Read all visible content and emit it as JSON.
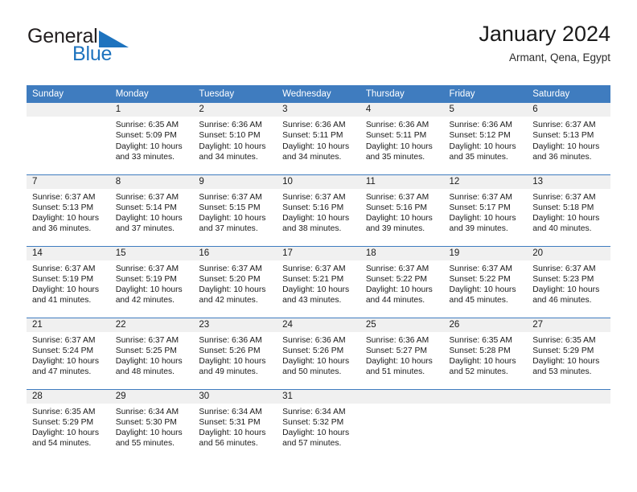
{
  "brand": {
    "name_part1": "General",
    "name_part2": "Blue",
    "flag_icon": "blue-triangle-flag-icon",
    "color_dark": "#231f20",
    "color_blue": "#1e73be"
  },
  "header": {
    "title": "January 2024",
    "subtitle": "Armant, Qena, Egypt"
  },
  "theme": {
    "header_row_bg": "#3f7cbf",
    "header_row_text": "#ffffff",
    "daynum_bg": "#f0f0f0",
    "cell_bg": "#ffffff",
    "grid_line": "#3f7cbf"
  },
  "calendar": {
    "weekday_headers": [
      "Sunday",
      "Monday",
      "Tuesday",
      "Wednesday",
      "Thursday",
      "Friday",
      "Saturday"
    ],
    "weeks": [
      [
        {
          "day": "",
          "empty": true,
          "line1": "",
          "line2": "",
          "line3": "",
          "line4": ""
        },
        {
          "day": "1",
          "empty": false,
          "line1": "Sunrise: 6:35 AM",
          "line2": "Sunset: 5:09 PM",
          "line3": "Daylight: 10 hours",
          "line4": "and 33 minutes."
        },
        {
          "day": "2",
          "empty": false,
          "line1": "Sunrise: 6:36 AM",
          "line2": "Sunset: 5:10 PM",
          "line3": "Daylight: 10 hours",
          "line4": "and 34 minutes."
        },
        {
          "day": "3",
          "empty": false,
          "line1": "Sunrise: 6:36 AM",
          "line2": "Sunset: 5:11 PM",
          "line3": "Daylight: 10 hours",
          "line4": "and 34 minutes."
        },
        {
          "day": "4",
          "empty": false,
          "line1": "Sunrise: 6:36 AM",
          "line2": "Sunset: 5:11 PM",
          "line3": "Daylight: 10 hours",
          "line4": "and 35 minutes."
        },
        {
          "day": "5",
          "empty": false,
          "line1": "Sunrise: 6:36 AM",
          "line2": "Sunset: 5:12 PM",
          "line3": "Daylight: 10 hours",
          "line4": "and 35 minutes."
        },
        {
          "day": "6",
          "empty": false,
          "line1": "Sunrise: 6:37 AM",
          "line2": "Sunset: 5:13 PM",
          "line3": "Daylight: 10 hours",
          "line4": "and 36 minutes."
        }
      ],
      [
        {
          "day": "7",
          "empty": false,
          "line1": "Sunrise: 6:37 AM",
          "line2": "Sunset: 5:13 PM",
          "line3": "Daylight: 10 hours",
          "line4": "and 36 minutes."
        },
        {
          "day": "8",
          "empty": false,
          "line1": "Sunrise: 6:37 AM",
          "line2": "Sunset: 5:14 PM",
          "line3": "Daylight: 10 hours",
          "line4": "and 37 minutes."
        },
        {
          "day": "9",
          "empty": false,
          "line1": "Sunrise: 6:37 AM",
          "line2": "Sunset: 5:15 PM",
          "line3": "Daylight: 10 hours",
          "line4": "and 37 minutes."
        },
        {
          "day": "10",
          "empty": false,
          "line1": "Sunrise: 6:37 AM",
          "line2": "Sunset: 5:16 PM",
          "line3": "Daylight: 10 hours",
          "line4": "and 38 minutes."
        },
        {
          "day": "11",
          "empty": false,
          "line1": "Sunrise: 6:37 AM",
          "line2": "Sunset: 5:16 PM",
          "line3": "Daylight: 10 hours",
          "line4": "and 39 minutes."
        },
        {
          "day": "12",
          "empty": false,
          "line1": "Sunrise: 6:37 AM",
          "line2": "Sunset: 5:17 PM",
          "line3": "Daylight: 10 hours",
          "line4": "and 39 minutes."
        },
        {
          "day": "13",
          "empty": false,
          "line1": "Sunrise: 6:37 AM",
          "line2": "Sunset: 5:18 PM",
          "line3": "Daylight: 10 hours",
          "line4": "and 40 minutes."
        }
      ],
      [
        {
          "day": "14",
          "empty": false,
          "line1": "Sunrise: 6:37 AM",
          "line2": "Sunset: 5:19 PM",
          "line3": "Daylight: 10 hours",
          "line4": "and 41 minutes."
        },
        {
          "day": "15",
          "empty": false,
          "line1": "Sunrise: 6:37 AM",
          "line2": "Sunset: 5:19 PM",
          "line3": "Daylight: 10 hours",
          "line4": "and 42 minutes."
        },
        {
          "day": "16",
          "empty": false,
          "line1": "Sunrise: 6:37 AM",
          "line2": "Sunset: 5:20 PM",
          "line3": "Daylight: 10 hours",
          "line4": "and 42 minutes."
        },
        {
          "day": "17",
          "empty": false,
          "line1": "Sunrise: 6:37 AM",
          "line2": "Sunset: 5:21 PM",
          "line3": "Daylight: 10 hours",
          "line4": "and 43 minutes."
        },
        {
          "day": "18",
          "empty": false,
          "line1": "Sunrise: 6:37 AM",
          "line2": "Sunset: 5:22 PM",
          "line3": "Daylight: 10 hours",
          "line4": "and 44 minutes."
        },
        {
          "day": "19",
          "empty": false,
          "line1": "Sunrise: 6:37 AM",
          "line2": "Sunset: 5:22 PM",
          "line3": "Daylight: 10 hours",
          "line4": "and 45 minutes."
        },
        {
          "day": "20",
          "empty": false,
          "line1": "Sunrise: 6:37 AM",
          "line2": "Sunset: 5:23 PM",
          "line3": "Daylight: 10 hours",
          "line4": "and 46 minutes."
        }
      ],
      [
        {
          "day": "21",
          "empty": false,
          "line1": "Sunrise: 6:37 AM",
          "line2": "Sunset: 5:24 PM",
          "line3": "Daylight: 10 hours",
          "line4": "and 47 minutes."
        },
        {
          "day": "22",
          "empty": false,
          "line1": "Sunrise: 6:37 AM",
          "line2": "Sunset: 5:25 PM",
          "line3": "Daylight: 10 hours",
          "line4": "and 48 minutes."
        },
        {
          "day": "23",
          "empty": false,
          "line1": "Sunrise: 6:36 AM",
          "line2": "Sunset: 5:26 PM",
          "line3": "Daylight: 10 hours",
          "line4": "and 49 minutes."
        },
        {
          "day": "24",
          "empty": false,
          "line1": "Sunrise: 6:36 AM",
          "line2": "Sunset: 5:26 PM",
          "line3": "Daylight: 10 hours",
          "line4": "and 50 minutes."
        },
        {
          "day": "25",
          "empty": false,
          "line1": "Sunrise: 6:36 AM",
          "line2": "Sunset: 5:27 PM",
          "line3": "Daylight: 10 hours",
          "line4": "and 51 minutes."
        },
        {
          "day": "26",
          "empty": false,
          "line1": "Sunrise: 6:35 AM",
          "line2": "Sunset: 5:28 PM",
          "line3": "Daylight: 10 hours",
          "line4": "and 52 minutes."
        },
        {
          "day": "27",
          "empty": false,
          "line1": "Sunrise: 6:35 AM",
          "line2": "Sunset: 5:29 PM",
          "line3": "Daylight: 10 hours",
          "line4": "and 53 minutes."
        }
      ],
      [
        {
          "day": "28",
          "empty": false,
          "line1": "Sunrise: 6:35 AM",
          "line2": "Sunset: 5:29 PM",
          "line3": "Daylight: 10 hours",
          "line4": "and 54 minutes."
        },
        {
          "day": "29",
          "empty": false,
          "line1": "Sunrise: 6:34 AM",
          "line2": "Sunset: 5:30 PM",
          "line3": "Daylight: 10 hours",
          "line4": "and 55 minutes."
        },
        {
          "day": "30",
          "empty": false,
          "line1": "Sunrise: 6:34 AM",
          "line2": "Sunset: 5:31 PM",
          "line3": "Daylight: 10 hours",
          "line4": "and 56 minutes."
        },
        {
          "day": "31",
          "empty": false,
          "line1": "Sunrise: 6:34 AM",
          "line2": "Sunset: 5:32 PM",
          "line3": "Daylight: 10 hours",
          "line4": "and 57 minutes."
        },
        {
          "day": "",
          "empty": true,
          "line1": "",
          "line2": "",
          "line3": "",
          "line4": ""
        },
        {
          "day": "",
          "empty": true,
          "line1": "",
          "line2": "",
          "line3": "",
          "line4": ""
        },
        {
          "day": "",
          "empty": true,
          "line1": "",
          "line2": "",
          "line3": "",
          "line4": ""
        }
      ]
    ]
  }
}
